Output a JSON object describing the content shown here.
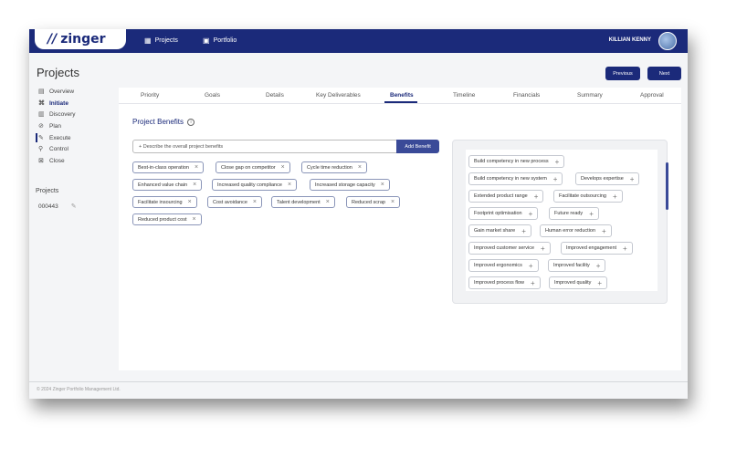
{
  "app": {
    "logo_mark": "//",
    "logo_text": "zinger",
    "nav": [
      {
        "icon": "grid-icon",
        "label": "Projects"
      },
      {
        "icon": "briefcase-icon",
        "label": "Portfolio"
      }
    ],
    "user_name": "KILLIAN KENNY"
  },
  "page": {
    "title": "Projects",
    "previous_label": "Previous",
    "next_label": "Next"
  },
  "sidebar": {
    "items": [
      {
        "icon": "document-icon",
        "label": "Overview",
        "active": false
      },
      {
        "icon": "initiate-icon",
        "label": "Initiate",
        "active": true
      },
      {
        "icon": "discovery-icon",
        "label": "Discovery",
        "active": false
      },
      {
        "icon": "plan-icon",
        "label": "Plan",
        "active": false
      },
      {
        "icon": "execute-icon",
        "label": "Execute",
        "active": false
      },
      {
        "icon": "control-icon",
        "label": "Control",
        "active": false
      },
      {
        "icon": "close-icon",
        "label": "Close",
        "active": false
      }
    ],
    "projects_label": "Projects",
    "project_id": "000443"
  },
  "tabs": [
    {
      "label": "Priority"
    },
    {
      "label": "Goals"
    },
    {
      "label": "Details"
    },
    {
      "label": "Key Deliverables"
    },
    {
      "label": "Benefits",
      "active": true
    },
    {
      "label": "Timeline"
    },
    {
      "label": "Financials"
    },
    {
      "label": "Summary"
    },
    {
      "label": "Approval"
    }
  ],
  "benefits": {
    "section_title": "Project Benefits",
    "input_value": "+ Describe the overall project benefits",
    "add_button": "Add Benefit",
    "selected": [
      "Best-in-class operation",
      "Close gap on competitor",
      "Cycle time reduction",
      "Enhanced value chain",
      "Increased quality compliance",
      "Increased storage capacity",
      "Facilitate insourcing",
      "Cost avoidance",
      "Talent development",
      "Reduced scrap",
      "Reduced product cost"
    ],
    "suggestions": [
      "Build competency in new process",
      "Build competency in new system",
      "Develops expertise",
      "Extended product range",
      "Facilitate outsourcing",
      "Footprint optimisation",
      "Future ready",
      "Gain market share",
      "Human error reduction",
      "Improved customer service",
      "Improved engagement",
      "Improved ergonomics",
      "Improved facility",
      "Improved process flow",
      "Improved quality"
    ]
  },
  "footer": "© 2024 Zinger Portfolio Management Ltd.",
  "colors": {
    "brand": "#1b2a7a",
    "button": "#3a4a98"
  }
}
